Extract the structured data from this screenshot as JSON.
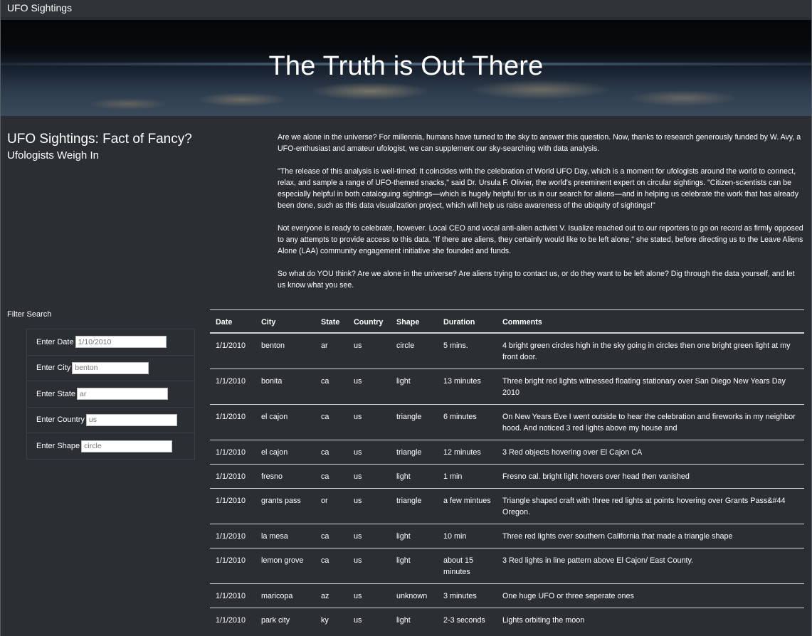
{
  "navbar": {
    "brand": "UFO Sightings"
  },
  "hero": {
    "title": "The Truth is Out There"
  },
  "left": {
    "heading": "UFO Sightings: Fact of Fancy?",
    "subheading": "Ufologists Weigh In"
  },
  "article": {
    "paragraphs": [
      "Are we alone in the universe? For millennia, humans have turned to the sky to answer this question. Now, thanks to research generously funded by W. Avy, a UFO-enthusiast and amateur ufologist, we can supplement our sky-searching with data analysis.",
      "\"The release of this analysis is well-timed: It coincides with the celebration of World UFO Day, which is a moment for ufologists around the world to connect, relax, and sample a range of UFO-themed snacks,\" said Dr. Ursula F. Olivier, the world's preeminent expert on circular sightings. \"Citizen-scientists can be especially helpful in both cataloguing sightings—which is hugely helpful for us in our search for aliens—and in helping us celebrate the work that has already been done, such as this data visualization project, which will help us raise awareness of the ubiquity of sightings!\"",
      "Not everyone is ready to celebrate, however. Local CEO and vocal anti-alien activist V. Isualize reached out to our reporters to go on record as firmly opposed to any attempts to provide access to this data. \"If there are aliens, they certainly would like to be left alone,\" she stated, before directing us to the Leave Aliens Alone (LAA) community engagement initiative she founded and funds.",
      "So what do YOU think? Are we alone in the universe? Are aliens trying to contact us, or do they want to be left alone? Dig through the data yourself, and let us know what you see."
    ]
  },
  "filters": {
    "title": "Filter Search",
    "date": {
      "label": "Enter Date",
      "placeholder": "1/10/2010"
    },
    "city": {
      "label": "Enter City",
      "placeholder": "benton"
    },
    "state": {
      "label": "Enter State",
      "placeholder": "ar"
    },
    "country": {
      "label": "Enter Country",
      "placeholder": "us"
    },
    "shape": {
      "label": "Enter Shape",
      "placeholder": "circle"
    }
  },
  "table": {
    "headers": [
      "Date",
      "City",
      "State",
      "Country",
      "Shape",
      "Duration",
      "Comments"
    ],
    "rows": [
      [
        "1/1/2010",
        "benton",
        "ar",
        "us",
        "circle",
        "5 mins.",
        "4 bright green circles high in the sky going in circles then one bright green light at my front door."
      ],
      [
        "1/1/2010",
        "bonita",
        "ca",
        "us",
        "light",
        "13 minutes",
        "Three bright red lights witnessed floating stationary over San Diego New Years Day 2010"
      ],
      [
        "1/1/2010",
        "el cajon",
        "ca",
        "us",
        "triangle",
        "6 minutes",
        "On New Years Eve I went outside to hear the celebration and fireworks in my neighbor hood. And noticed 3 red lights above my house and"
      ],
      [
        "1/1/2010",
        "el cajon",
        "ca",
        "us",
        "triangle",
        "12 minutes",
        "3 Red objects hovering over El Cajon CA"
      ],
      [
        "1/1/2010",
        "fresno",
        "ca",
        "us",
        "light",
        "1 min",
        "Fresno cal. bright light hovers over head then vanished"
      ],
      [
        "1/1/2010",
        "grants pass",
        "or",
        "us",
        "triangle",
        "a few mintues",
        "Triangle shaped craft with three red lights at points hovering over Grants Pass&#44 Oregon."
      ],
      [
        "1/1/2010",
        "la mesa",
        "ca",
        "us",
        "light",
        "10 min",
        "Three red lights over southern California that made a triangle shape"
      ],
      [
        "1/1/2010",
        "lemon grove",
        "ca",
        "us",
        "light",
        "about 15 minutes",
        "3 Red lights in line pattern above El Cajon/ East County."
      ],
      [
        "1/1/2010",
        "maricopa",
        "az",
        "us",
        "unknown",
        "3 minutes",
        "One huge UFO or three seperate ones"
      ],
      [
        "1/1/2010",
        "park city",
        "ky",
        "us",
        "light",
        "2-3 seconds",
        "Lights orbiting the moon"
      ]
    ]
  }
}
